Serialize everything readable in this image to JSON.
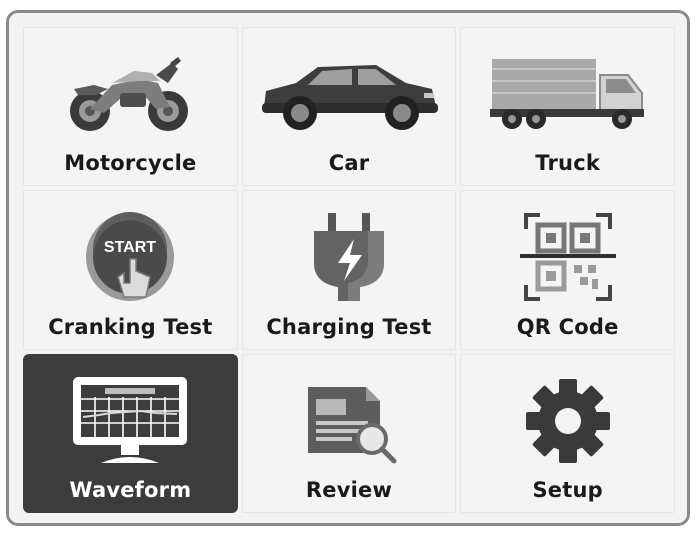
{
  "menu": {
    "selected": "waveform",
    "items": [
      {
        "id": "motorcycle",
        "label": "Motorcycle",
        "icon": "motorcycle-icon"
      },
      {
        "id": "car",
        "label": "Car",
        "icon": "car-icon"
      },
      {
        "id": "truck",
        "label": "Truck",
        "icon": "truck-icon"
      },
      {
        "id": "cranking-test",
        "label": "Cranking Test",
        "icon": "start-button-icon",
        "icon_text": "START"
      },
      {
        "id": "charging-test",
        "label": "Charging Test",
        "icon": "plug-lightning-icon"
      },
      {
        "id": "qr-code",
        "label": "QR Code",
        "icon": "qr-code-icon"
      },
      {
        "id": "waveform",
        "label": "Waveform",
        "icon": "monitor-waveform-icon"
      },
      {
        "id": "review",
        "label": "Review",
        "icon": "document-magnifier-icon"
      },
      {
        "id": "setup",
        "label": "Setup",
        "icon": "gear-icon"
      }
    ]
  },
  "colors": {
    "tile_background": "#f4f4f4",
    "selected_tile_background": "#3c3c3c",
    "label_text": "#1a1a1a",
    "selected_label_text": "#ffffff",
    "icon_dark": "#333333",
    "icon_mid": "#6b6b6b",
    "icon_light": "#b5b5b5"
  }
}
